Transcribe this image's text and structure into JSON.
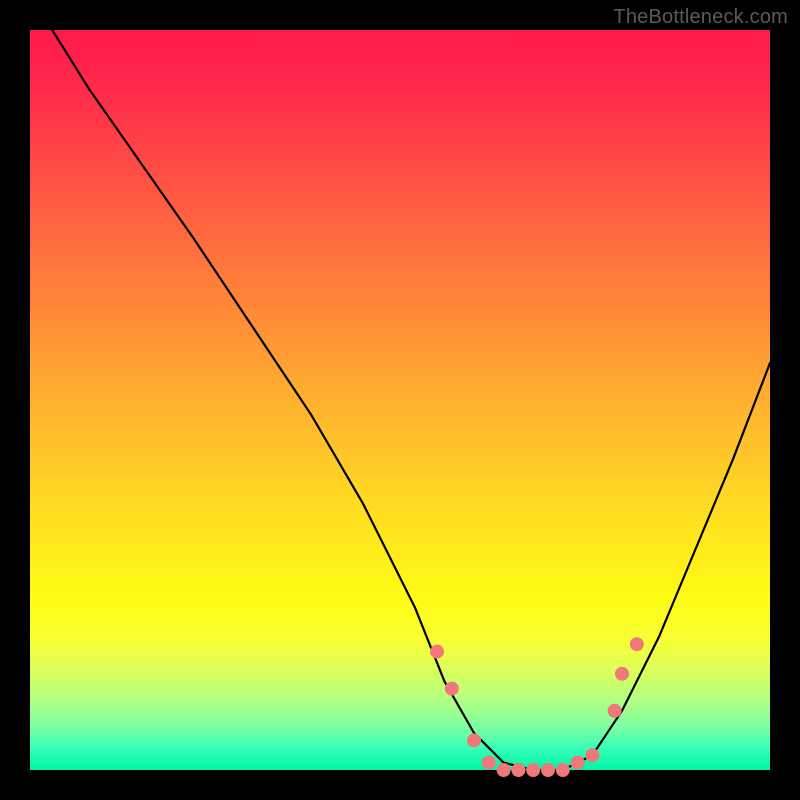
{
  "watermark": "TheBottleneck.com",
  "colors": {
    "gradient_top": "#ff1a4d",
    "gradient_mid": "#ffe020",
    "gradient_bottom": "#00f5a8",
    "curve": "#000000",
    "dots": "#f07878",
    "background": "#000000"
  },
  "chart_data": {
    "type": "line",
    "title": "",
    "xlabel": "",
    "ylabel": "",
    "xlim": [
      0,
      100
    ],
    "ylim": [
      0,
      100
    ],
    "grid": false,
    "legend": false,
    "series": [
      {
        "name": "bottleneck-curve",
        "x": [
          3,
          8,
          15,
          22,
          30,
          38,
          45,
          52,
          56,
          60,
          64,
          68,
          72,
          76,
          80,
          85,
          90,
          95,
          100
        ],
        "y": [
          100,
          92,
          82,
          72,
          60,
          48,
          36,
          22,
          12,
          5,
          1,
          0,
          0,
          2,
          8,
          18,
          30,
          42,
          55
        ]
      }
    ],
    "markers": [
      {
        "name": "dot",
        "x": 55,
        "y": 16
      },
      {
        "name": "dot",
        "x": 57,
        "y": 11
      },
      {
        "name": "dot",
        "x": 60,
        "y": 4
      },
      {
        "name": "dot",
        "x": 62,
        "y": 1
      },
      {
        "name": "dot",
        "x": 64,
        "y": 0
      },
      {
        "name": "dot",
        "x": 66,
        "y": 0
      },
      {
        "name": "dot",
        "x": 68,
        "y": 0
      },
      {
        "name": "dot",
        "x": 70,
        "y": 0
      },
      {
        "name": "dot",
        "x": 72,
        "y": 0
      },
      {
        "name": "dot",
        "x": 74,
        "y": 1
      },
      {
        "name": "dot",
        "x": 76,
        "y": 2
      },
      {
        "name": "dot",
        "x": 79,
        "y": 8
      },
      {
        "name": "dot",
        "x": 80,
        "y": 13
      },
      {
        "name": "dot",
        "x": 82,
        "y": 17
      }
    ],
    "annotations": []
  }
}
